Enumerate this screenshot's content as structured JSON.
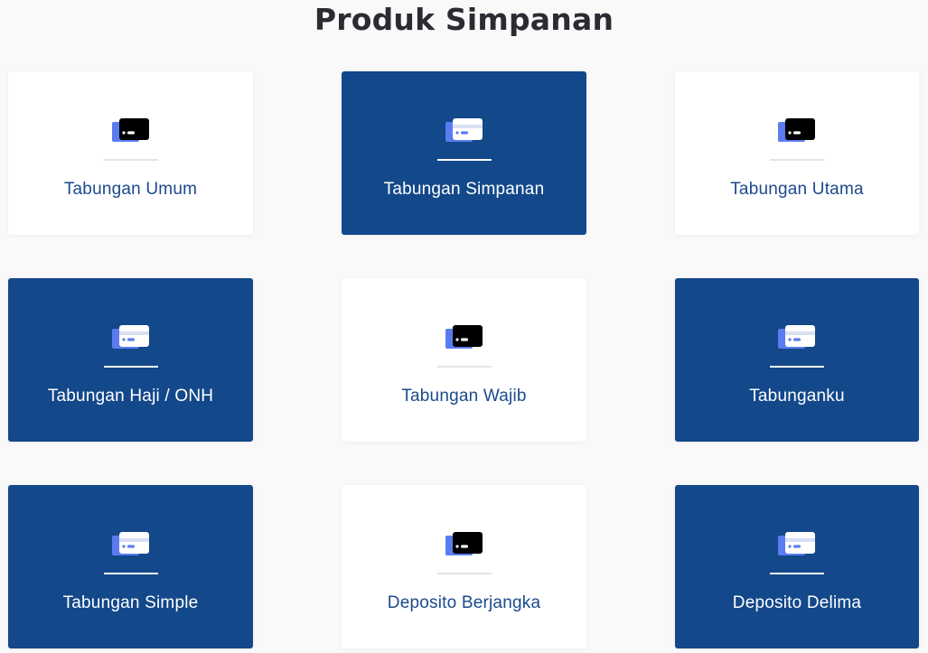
{
  "page": {
    "title": "Produk Simpanan"
  },
  "colors": {
    "primary_dark": "#13488a",
    "card_light": "#ffffff",
    "label_blue": "#1b4a8c",
    "icon_accent": "#5b7cf0"
  },
  "products": [
    {
      "label": "Tabungan Umum",
      "theme": "light",
      "icon": "credit-card-icon"
    },
    {
      "label": "Tabungan Simpanan",
      "theme": "dark",
      "icon": "credit-card-icon"
    },
    {
      "label": "Tabungan Utama",
      "theme": "light",
      "icon": "credit-card-icon"
    },
    {
      "label": "Tabungan Haji / ONH",
      "theme": "dark",
      "icon": "credit-card-icon"
    },
    {
      "label": "Tabungan Wajib",
      "theme": "light",
      "icon": "credit-card-icon"
    },
    {
      "label": "Tabunganku",
      "theme": "dark",
      "icon": "credit-card-icon"
    },
    {
      "label": "Tabungan Simple",
      "theme": "dark",
      "icon": "credit-card-icon"
    },
    {
      "label": "Deposito Berjangka",
      "theme": "light",
      "icon": "credit-card-icon"
    },
    {
      "label": "Deposito Delima",
      "theme": "dark",
      "icon": "credit-card-icon"
    }
  ]
}
